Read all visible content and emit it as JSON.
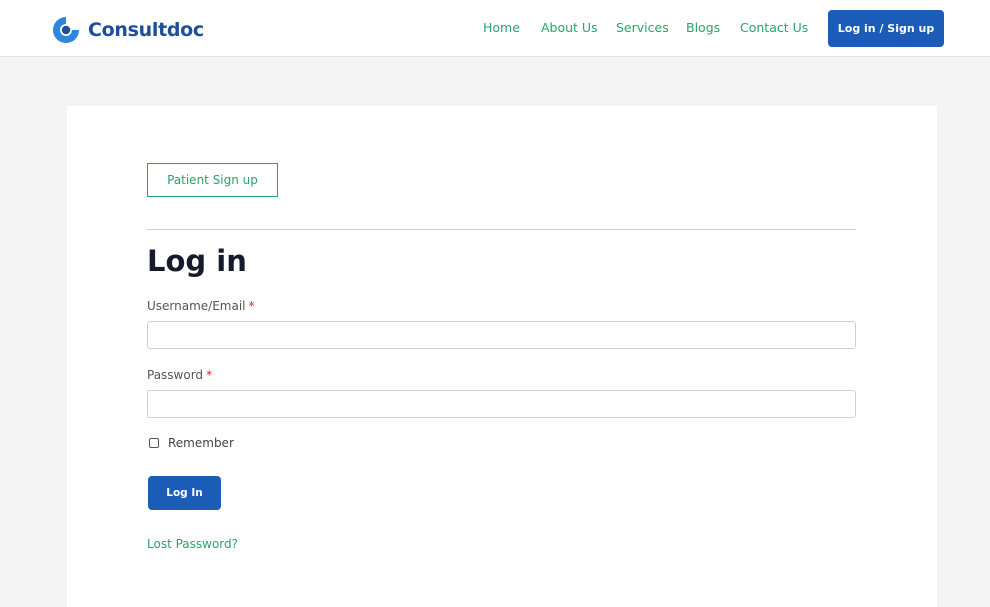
{
  "brand": {
    "name": "Consultdoc",
    "icon": "consultdoc-logo-icon",
    "colors": {
      "primary_blue": "#1a5cb8",
      "logo_blue": "#1d4e9a",
      "accent_green": "#28a56a"
    }
  },
  "nav": {
    "items": [
      {
        "label": "Home"
      },
      {
        "label": "About Us"
      },
      {
        "label": "Services"
      },
      {
        "label": "Blogs"
      },
      {
        "label": "Contact Us"
      }
    ],
    "cta_label": "Log in / Sign up"
  },
  "form": {
    "signup_tab_label": "Patient Sign up",
    "title": "Log in",
    "username_label": "Username/Email",
    "username_value": "",
    "password_label": "Password",
    "password_value": "",
    "required_mark": "*",
    "remember_label": "Remember",
    "remember_checked": false,
    "submit_label": "Log In",
    "lost_password_label": "Lost Password?"
  }
}
